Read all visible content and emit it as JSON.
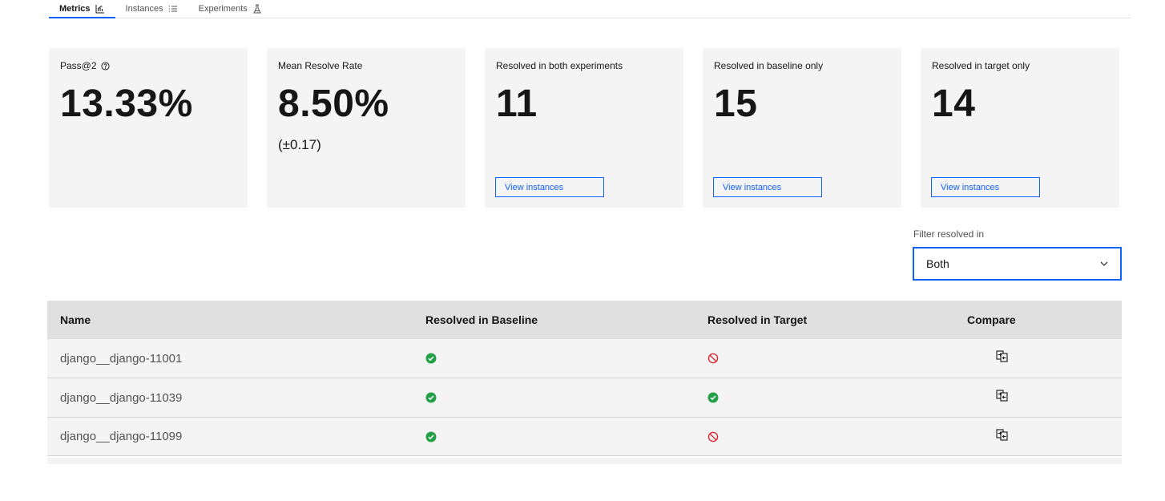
{
  "tabs": [
    {
      "label": "Metrics",
      "icon": "chart-icon",
      "active": true
    },
    {
      "label": "Instances",
      "icon": "list-icon",
      "active": false
    },
    {
      "label": "Experiments",
      "icon": "flask-icon",
      "active": false
    }
  ],
  "tiles": [
    {
      "label": "Pass@2",
      "value": "13.33%",
      "has_help": true
    },
    {
      "label": "Mean Resolve Rate",
      "value": "8.50%",
      "sub": "(±0.17)"
    },
    {
      "label": "Resolved in both experiments",
      "value": "11",
      "button": "View instances"
    },
    {
      "label": "Resolved in baseline only",
      "value": "15",
      "button": "View instances"
    },
    {
      "label": "Resolved in target only",
      "value": "14",
      "button": "View instances"
    }
  ],
  "filter": {
    "label": "Filter resolved in",
    "value": "Both"
  },
  "table": {
    "headers": [
      "Name",
      "Resolved in Baseline",
      "Resolved in Target",
      "Compare"
    ],
    "rows": [
      {
        "name": "django__django-11001",
        "baseline": "resolved",
        "target": "not-resolved"
      },
      {
        "name": "django__django-11039",
        "baseline": "resolved",
        "target": "resolved"
      },
      {
        "name": "django__django-11099",
        "baseline": "resolved",
        "target": "not-resolved"
      }
    ]
  },
  "colors": {
    "accent": "#0f62fe",
    "success": "#24a148",
    "error": "#da1e28"
  }
}
